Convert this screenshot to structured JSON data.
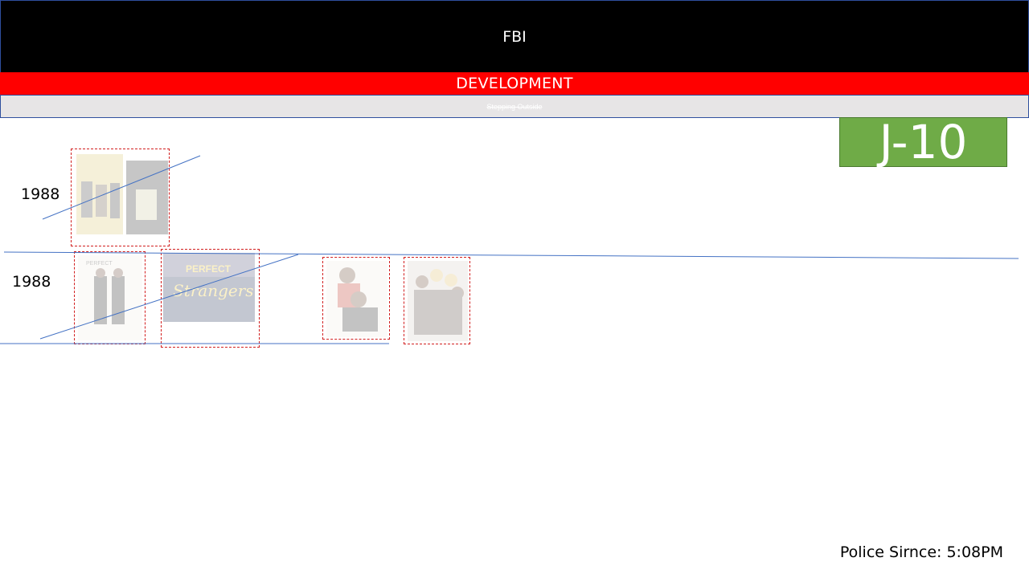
{
  "header": {
    "title": "FBI",
    "subtitle": "DEVELOPMENT",
    "note": "Stepping Outside"
  },
  "badge": {
    "label": "J-10",
    "color": "#6fab47"
  },
  "rows": [
    {
      "year": "1988"
    },
    {
      "year": "1988"
    }
  ],
  "footer": {
    "label": "Police Sirnce:",
    "time": "5:08PM"
  },
  "colors": {
    "header_bg": "#000000",
    "band_red": "#ff0000",
    "band_grey": "#e7e5e6",
    "line_blue": "#4472c4",
    "frame_red": "#d21f1f"
  }
}
